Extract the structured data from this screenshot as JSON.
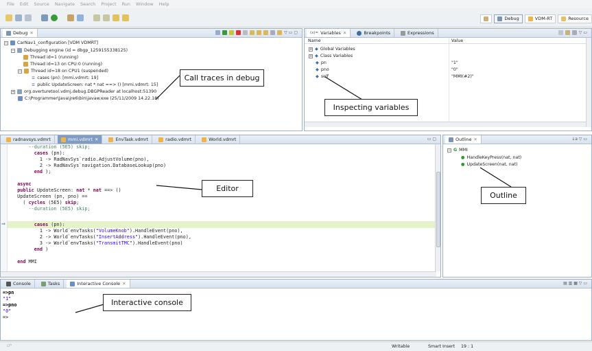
{
  "menu": [
    "File",
    "Edit",
    "Source",
    "Navigate",
    "Search",
    "Project",
    "Run",
    "Window",
    "Help"
  ],
  "perspectives": {
    "debug": "Debug",
    "vdmrt": "VDM-RT",
    "resource": "Resource"
  },
  "debug_view": {
    "tab": "Debug",
    "tree": [
      "CarNav1_configuration [VDM VDMRT]",
      "Debugging engine (id = dbgp_1259155338125)",
      "Thread id=1 (running)",
      "Thread id=13 on CPU:0 (running)",
      "Thread id=18 on CPU1 (suspended)",
      "cases (pn): [mmi.vdmrt: 19]",
      "public UpdateScreen: nat * nat ==> () [mmi.vdmrt: 15]",
      "org.overturetool.vdmj.debug.DBGPReader at localhost:51390",
      "C:\\Programmer\\Java\\jre6\\bin\\javaw.exe (25/11/2009 14.22.18)"
    ]
  },
  "variables_view": {
    "tabs": [
      "Variables",
      "Breakpoints",
      "Expressions"
    ],
    "col_name": "Name",
    "col_value": "Value",
    "rows": [
      {
        "name": "Global Variables",
        "value": ""
      },
      {
        "name": "Class Variables",
        "value": ""
      },
      {
        "name": "pn",
        "value": "\"1\""
      },
      {
        "name": "pno",
        "value": "\"0\""
      },
      {
        "name": "self",
        "value": "\"MMI(#2)\""
      }
    ]
  },
  "editor": {
    "tabs": [
      "radnavsys.vdmrt",
      "mmi.vdmrt",
      "EnvTask.vdmrt",
      "radio.vdmrt",
      "World.vdmrt"
    ]
  },
  "outline_view": {
    "tab": "Outline",
    "root": "MMI",
    "items": [
      "HandleKeyPress(nat, nat)",
      "UpdateScreen(nat, nat)"
    ]
  },
  "console_view": {
    "tabs": [
      "Console",
      "Tasks",
      "Interactive Console"
    ],
    "lines": [
      "=>pn",
      "\"1\"",
      "=>pno",
      "\"0\"",
      "=>"
    ]
  },
  "status": {
    "writable": "Writable",
    "insert": "Smart Insert",
    "position": "19 : 1"
  },
  "callouts": {
    "call_traces": "Call traces in debug",
    "inspecting": "Inspecting variables",
    "editor": "Editor",
    "outline": "Outline",
    "console": "Interactive console"
  },
  "colors": {
    "keyword": "#7f0055",
    "string": "#2a00ff",
    "comment": "#3f7f5f",
    "highlight": "#e6f2c9"
  }
}
